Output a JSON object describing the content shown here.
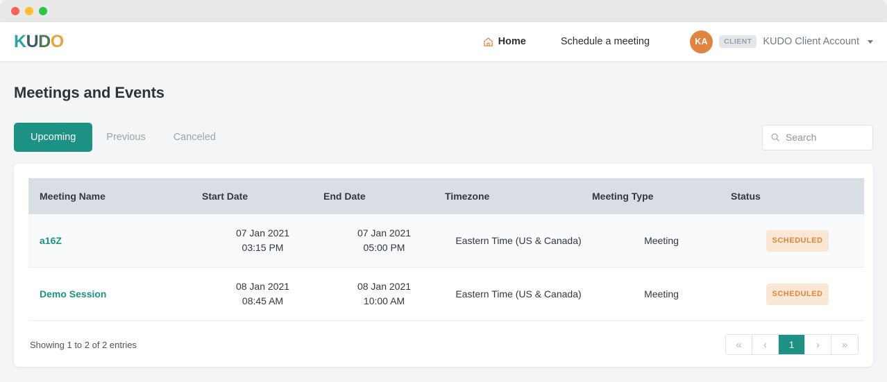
{
  "window": {
    "traffic_lights": [
      "close",
      "minimize",
      "zoom"
    ]
  },
  "navbar": {
    "logo": {
      "k": "K",
      "u": "U",
      "d": "D",
      "o": "O"
    },
    "home_label": "Home",
    "schedule_label": "Schedule a meeting",
    "account": {
      "initials": "KA",
      "role": "CLIENT",
      "name": "KUDO Client Account"
    }
  },
  "page": {
    "title": "Meetings and Events",
    "tabs": [
      {
        "label": "Upcoming",
        "active": true
      },
      {
        "label": "Previous",
        "active": false
      },
      {
        "label": "Canceled",
        "active": false
      }
    ],
    "search": {
      "value": "",
      "placeholder": "Search"
    }
  },
  "table": {
    "columns": [
      "Meeting Name",
      "Start Date",
      "End Date",
      "Timezone",
      "Meeting Type",
      "Status"
    ],
    "rows": [
      {
        "name": "a16Z",
        "start_date": "07 Jan 2021",
        "start_time": "03:15 PM",
        "end_date": "07 Jan 2021",
        "end_time": "05:00 PM",
        "timezone": "Eastern Time (US & Canada)",
        "type": "Meeting",
        "status": "SCHEDULED"
      },
      {
        "name": "Demo Session",
        "start_date": "08 Jan 2021",
        "start_time": "08:45 AM",
        "end_date": "08 Jan 2021",
        "end_time": "10:00 AM",
        "timezone": "Eastern Time (US & Canada)",
        "type": "Meeting",
        "status": "SCHEDULED"
      }
    ],
    "showing": "Showing 1 to 2 of 2 entries",
    "pagination": {
      "first": "«",
      "prev": "‹",
      "current": "1",
      "next": "›",
      "last": "»"
    }
  },
  "colors": {
    "accent_teal": "#1d9183",
    "accent_orange": "#e08440",
    "status_badge_bg": "#fbe7d6",
    "status_badge_text": "#df8636",
    "page_bg": "#f4f5f7",
    "table_head_bg": "#d9dee5"
  }
}
